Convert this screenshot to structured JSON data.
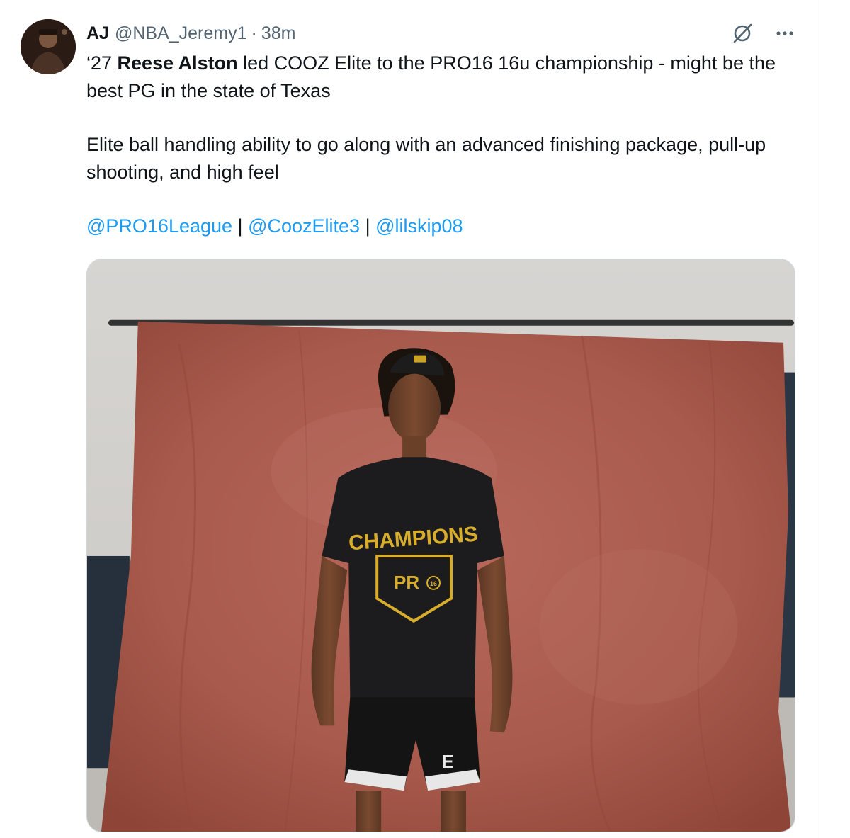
{
  "tweet": {
    "author": {
      "display_name": "AJ",
      "handle": "@NBA_Jeremy1",
      "separator": "·",
      "time": "38m"
    },
    "icons": {
      "grok": "grok-icon",
      "more": "more-options-icon"
    },
    "text": {
      "line1_prefix": "‘27 ",
      "line1_bold": "Reese Alston",
      "line1_rest": " led COOZ Elite to the PRO16 16u championship - might be the best PG in the state of Texas",
      "paragraph2": "Elite ball handling ability to go along with an advanced finishing package, pull-up shooting, and high feel"
    },
    "mentions": {
      "m1": "@PRO16League",
      "m2": "@CoozElite3",
      "m3": "@lilskip08",
      "sep": " | "
    },
    "media": {
      "shirt_text": "CHAMPIONS",
      "logo_text": "PR",
      "logo_number": "16",
      "shorts_letter": "E"
    }
  }
}
